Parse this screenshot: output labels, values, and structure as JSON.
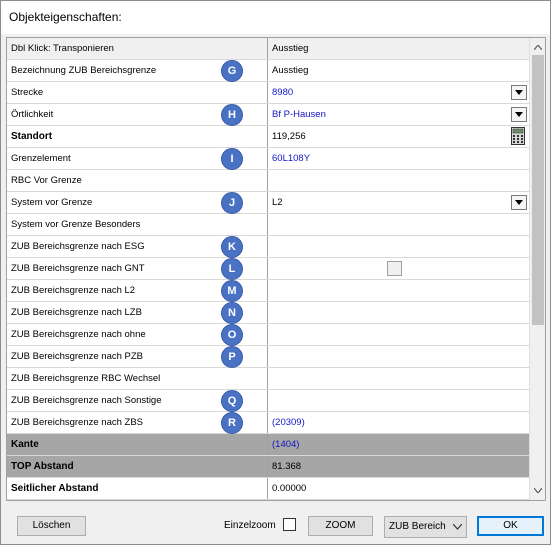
{
  "window": {
    "title": "Objekteigenschaften:"
  },
  "grid": {
    "header": {
      "label": "Dbl Klick: Transponieren",
      "value": "Ausstieg"
    },
    "rows": [
      {
        "label": "Bezeichnung ZUB Bereichsgrenze",
        "value": "Ausstieg",
        "badge": "G"
      },
      {
        "label": "Strecke",
        "value": "8980"
      },
      {
        "label": "Örtlichkeit",
        "value": "Bf P-Hausen",
        "badge": "H"
      },
      {
        "label": "Standort",
        "value": "119,256"
      },
      {
        "label": "Grenzelement",
        "value": "60L108Y",
        "badge": "I"
      },
      {
        "label": "RBC Vor Grenze",
        "value": ""
      },
      {
        "label": "System vor Grenze",
        "value": "L2",
        "badge": "J"
      },
      {
        "label": "System vor Grenze Besonders",
        "value": ""
      },
      {
        "label": "ZUB Bereichsgrenze nach ESG",
        "value": "",
        "badge": "K"
      },
      {
        "label": "ZUB Bereichsgrenze nach GNT",
        "value": "",
        "badge": "L"
      },
      {
        "label": "ZUB Bereichsgrenze nach L2",
        "value": "",
        "badge": "M"
      },
      {
        "label": "ZUB Bereichsgrenze nach LZB",
        "value": "",
        "badge": "N"
      },
      {
        "label": "ZUB Bereichsgrenze nach ohne",
        "value": "",
        "badge": "O"
      },
      {
        "label": "ZUB Bereichsgrenze nach PZB",
        "value": "",
        "badge": "P"
      },
      {
        "label": "ZUB Bereichsgrenze RBC Wechsel",
        "value": ""
      },
      {
        "label": "ZUB Bereichsgrenze nach Sonstige",
        "value": "",
        "badge": "Q"
      },
      {
        "label": "ZUB Bereichsgrenze nach ZBS",
        "value": "(20309)",
        "badge": "R"
      },
      {
        "label": "Kante",
        "value": "(1404)"
      },
      {
        "label": "TOP Abstand",
        "value": "81.368"
      },
      {
        "label": "Seitlicher Abstand",
        "value": "0.00000"
      }
    ]
  },
  "footer": {
    "delete_label": "Löschen",
    "single_zoom_label": "Einzelzoom",
    "zoom_label": "ZOOM",
    "select_value": "ZUB Bereich",
    "ok_label": "OK"
  },
  "colors": {
    "badge": "#4a72c4",
    "link_value": "#1414c8",
    "gray_row": "#a6a6a6",
    "ok_border": "#0078d7"
  },
  "icons": {
    "dropdown": "chevron-down-icon",
    "calculator": "calculator-icon",
    "scroll_up": "scroll-up-icon",
    "scroll_down": "scroll-down-icon"
  }
}
